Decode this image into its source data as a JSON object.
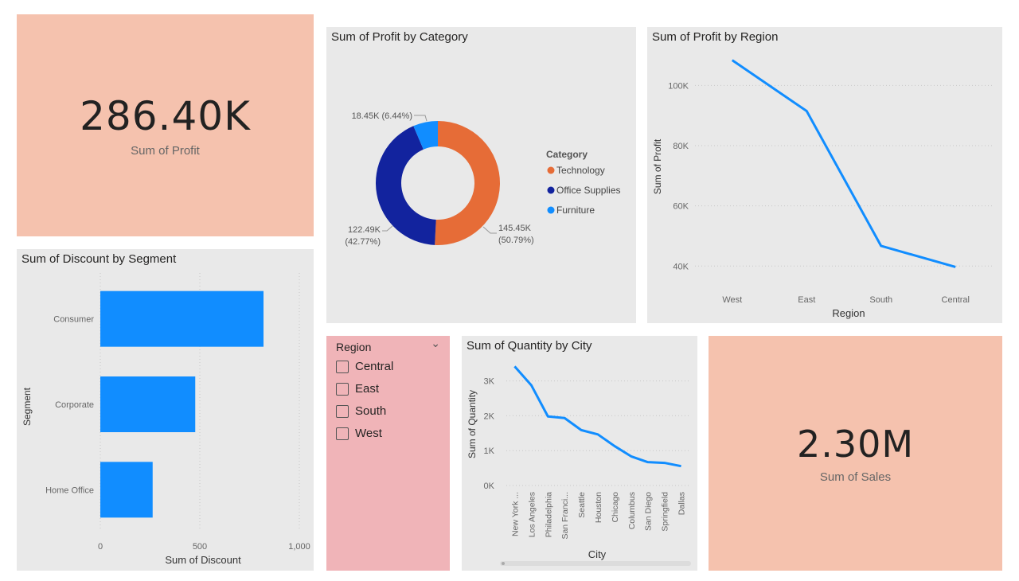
{
  "profit_card": {
    "value": "286.40K",
    "label": "Sum of Profit"
  },
  "sales_card": {
    "value": "2.30M",
    "label": "Sum of Sales"
  },
  "region_slicer": {
    "title": "Region",
    "chevron": "chevron-down-icon",
    "items": [
      "Central",
      "East",
      "South",
      "West"
    ]
  },
  "colors": {
    "card_bg": "#f5c2ae",
    "panel_bg": "#e9e9e9",
    "slicer_bg": "#f0b4b8",
    "bar_blue": "#118dff",
    "line_blue": "#118dff",
    "technology": "#e66c37",
    "office_supplies": "#12239e",
    "furniture": "#118dff"
  },
  "chart_data": [
    {
      "id": "category_donut",
      "type": "pie",
      "title": "Sum of Profit by Category",
      "legend_title": "Category",
      "legend_position": "right",
      "slices": [
        {
          "name": "Technology",
          "value": 145.45,
          "label_value": "145.45K",
          "label_pct": "(50.79%)",
          "color": "#e66c37"
        },
        {
          "name": "Office Supplies",
          "value": 122.49,
          "label_value": "122.49K",
          "label_pct": "(42.77%)",
          "color": "#12239e"
        },
        {
          "name": "Furniture",
          "value": 18.45,
          "label_value": "18.45K (6.44%)",
          "label_pct": "",
          "color": "#118dff"
        }
      ]
    },
    {
      "id": "region_line",
      "type": "line",
      "title": "Sum of Profit by Region",
      "xlabel": "Region",
      "ylabel": "Sum of Profit",
      "categories": [
        "West",
        "East",
        "South",
        "Central"
      ],
      "values": [
        108400,
        91500,
        46700,
        39700
      ],
      "ylim": [
        34000,
        112000
      ],
      "yticks": [
        40000,
        60000,
        80000,
        100000
      ],
      "ytick_labels": [
        "40K",
        "60K",
        "80K",
        "100K"
      ],
      "grid": true
    },
    {
      "id": "segment_bar",
      "type": "bar",
      "orientation": "horizontal",
      "title": "Sum of Discount by Segment",
      "xlabel": "Sum of Discount",
      "ylabel": "Segment",
      "categories": [
        "Consumer",
        "Corporate",
        "Home Office"
      ],
      "values": [
        820,
        477,
        263
      ],
      "xlim": [
        0,
        1000
      ],
      "xticks": [
        0,
        500,
        1000
      ],
      "xtick_labels": [
        "0",
        "500",
        "1,000"
      ],
      "grid": true
    },
    {
      "id": "city_line",
      "type": "line",
      "title": "Sum of Quantity by City",
      "xlabel": "City",
      "ylabel": "Sum of Quantity",
      "categories": [
        "New York ...",
        "Los Angeles",
        "Philadelphia",
        "San Franci...",
        "Seattle",
        "Houston",
        "Chicago",
        "Columbus",
        "San Diego",
        "Springfield",
        "Dallas"
      ],
      "values": [
        3417,
        2879,
        1981,
        1935,
        1590,
        1466,
        1132,
        836,
        670,
        649,
        555
      ],
      "ylim": [
        0,
        3700
      ],
      "yticks": [
        0,
        1000,
        2000,
        3000
      ],
      "ytick_labels": [
        "0K",
        "1K",
        "2K",
        "3K"
      ],
      "grid": true
    }
  ]
}
